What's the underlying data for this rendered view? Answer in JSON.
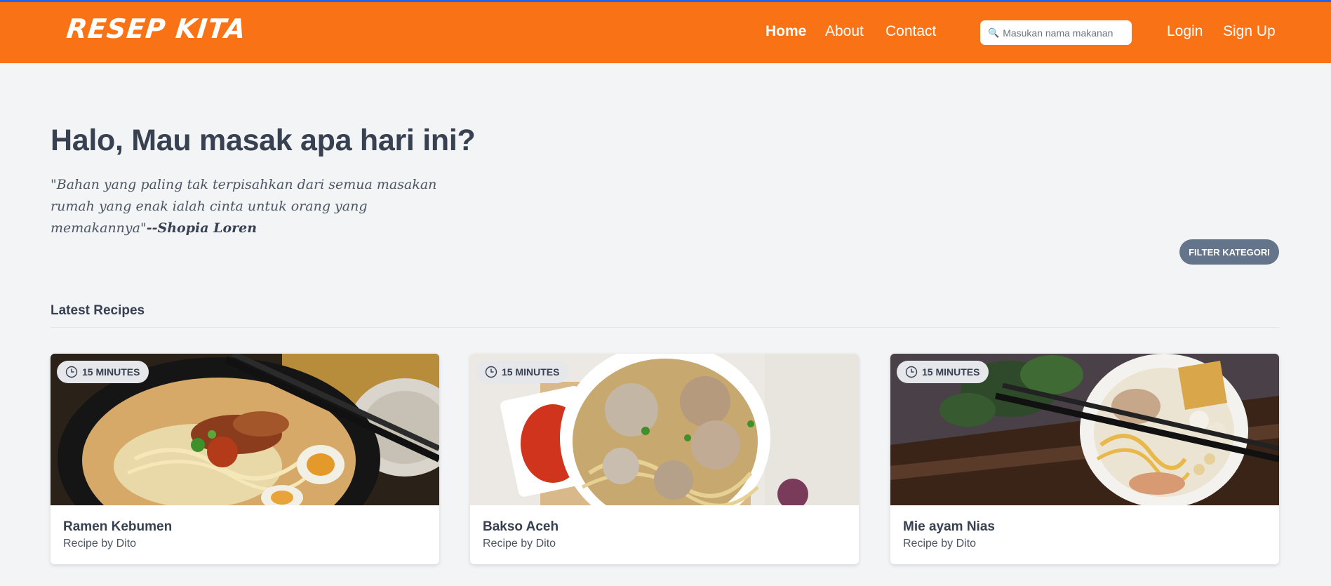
{
  "header": {
    "logo": "RESEP KITA",
    "nav": [
      "Home",
      "About",
      "Contact"
    ],
    "search_placeholder": "Masukan nama makanan",
    "login_label": "Login",
    "signup_label": "Sign Up"
  },
  "hero": {
    "title": "Halo, Mau masak apa hari ini?",
    "quote": "\"Bahan yang paling tak terpisahkan dari semua masakan rumah yang enak ialah cinta untuk orang yang memakannya\"",
    "quote_author": "--Shopia Loren"
  },
  "filter_label": "FILTER KATEGORI",
  "section_title": "Latest Recipes",
  "recipes": [
    {
      "title": "Ramen Kebumen",
      "author": "Recipe by Dito",
      "time": "15 MINUTES",
      "image": "ramen-photo"
    },
    {
      "title": "Bakso Aceh",
      "author": "Recipe by Dito",
      "time": "15 MINUTES",
      "image": "bakso-photo"
    },
    {
      "title": "Mie ayam Nias",
      "author": "Recipe by Dito",
      "time": "15 MINUTES",
      "image": "mie-ayam-photo"
    }
  ],
  "colors": {
    "header": "#f97316",
    "background": "#f3f4f6",
    "filter_button": "#64748b"
  },
  "icons": {
    "search": "search-icon",
    "clock": "clock-icon"
  }
}
